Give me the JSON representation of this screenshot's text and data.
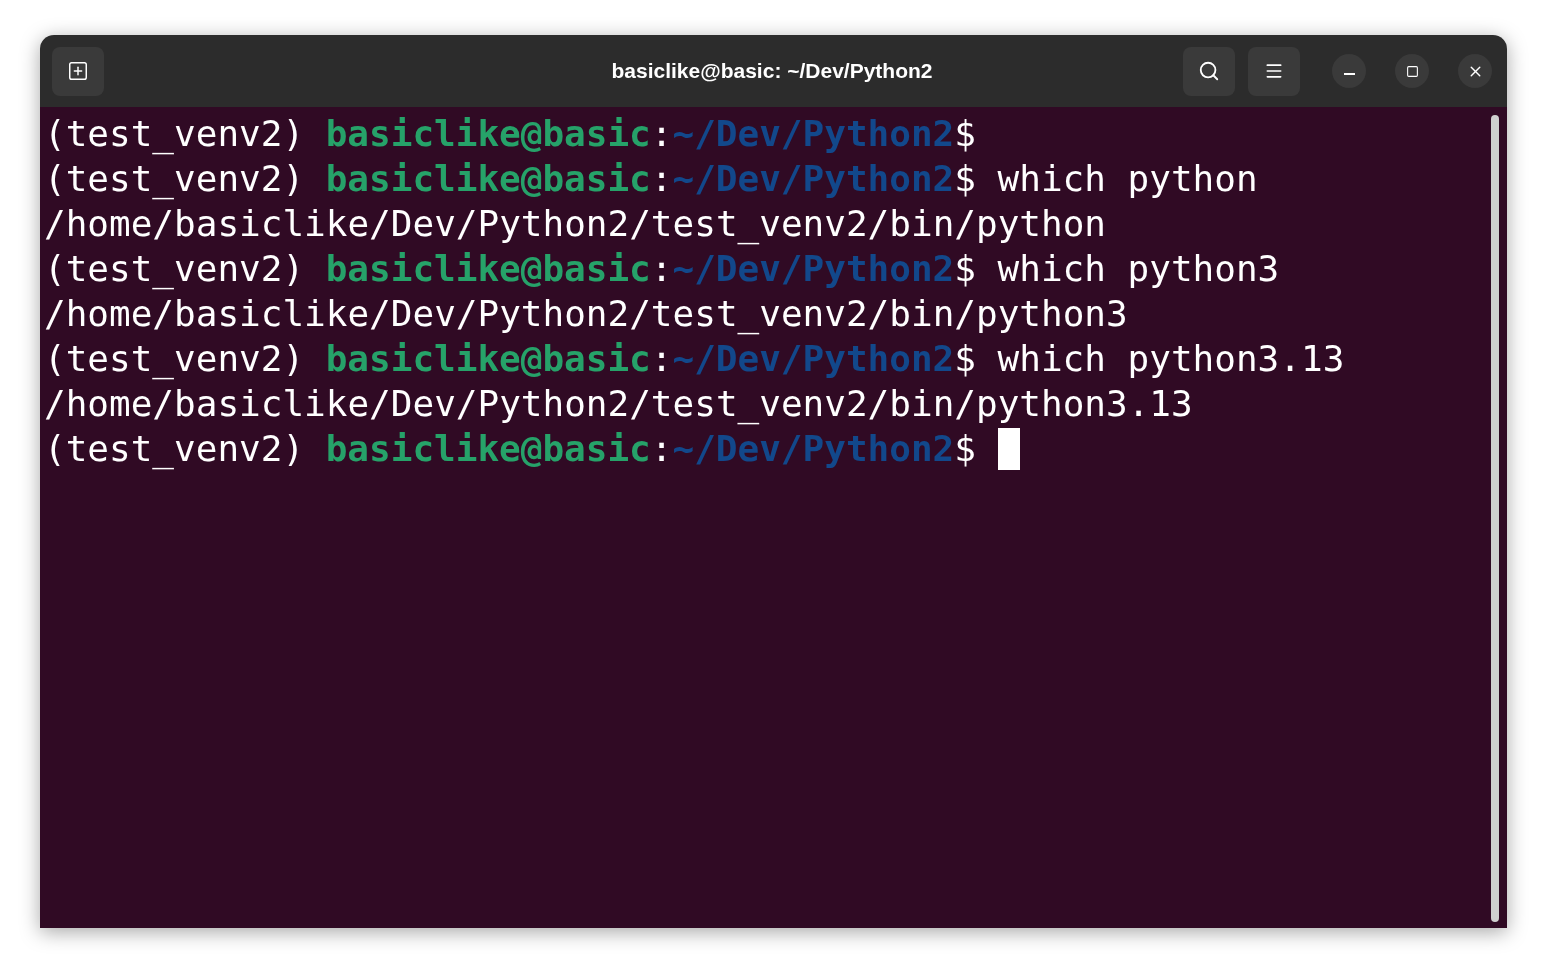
{
  "window": {
    "title": "basiclike@basic: ~/Dev/Python2"
  },
  "lines": [
    {
      "kind": "prompt",
      "env": "(test_venv2)",
      "user_host": "basiclike@basic",
      "separator": ":",
      "path": "~/Dev/Python2",
      "symbol": "$",
      "cursor": false
    },
    {
      "kind": "prompt",
      "env": "(test_venv2)",
      "user_host": "basiclike@basic",
      "separator": ":",
      "path": "~/Dev/Python2",
      "symbol": "$",
      "command": "which python",
      "cursor": false
    },
    {
      "kind": "output",
      "text": "/home/basiclike/Dev/Python2/test_venv2/bin/python"
    },
    {
      "kind": "prompt",
      "env": "(test_venv2)",
      "user_host": "basiclike@basic",
      "separator": ":",
      "path": "~/Dev/Python2",
      "symbol": "$",
      "command": "which python3",
      "cursor": false
    },
    {
      "kind": "output",
      "text": "/home/basiclike/Dev/Python2/test_venv2/bin/python3"
    },
    {
      "kind": "prompt",
      "env": "(test_venv2)",
      "user_host": "basiclike@basic",
      "separator": ":",
      "path": "~/Dev/Python2",
      "symbol": "$",
      "command": "which python3.13",
      "cursor": false
    },
    {
      "kind": "output",
      "text": "/home/basiclike/Dev/Python2/test_venv2/bin/python3.13"
    },
    {
      "kind": "prompt",
      "env": "(test_venv2)",
      "user_host": "basiclike@basic",
      "separator": ":",
      "path": "~/Dev/Python2",
      "symbol": "$",
      "cursor": true
    }
  ]
}
